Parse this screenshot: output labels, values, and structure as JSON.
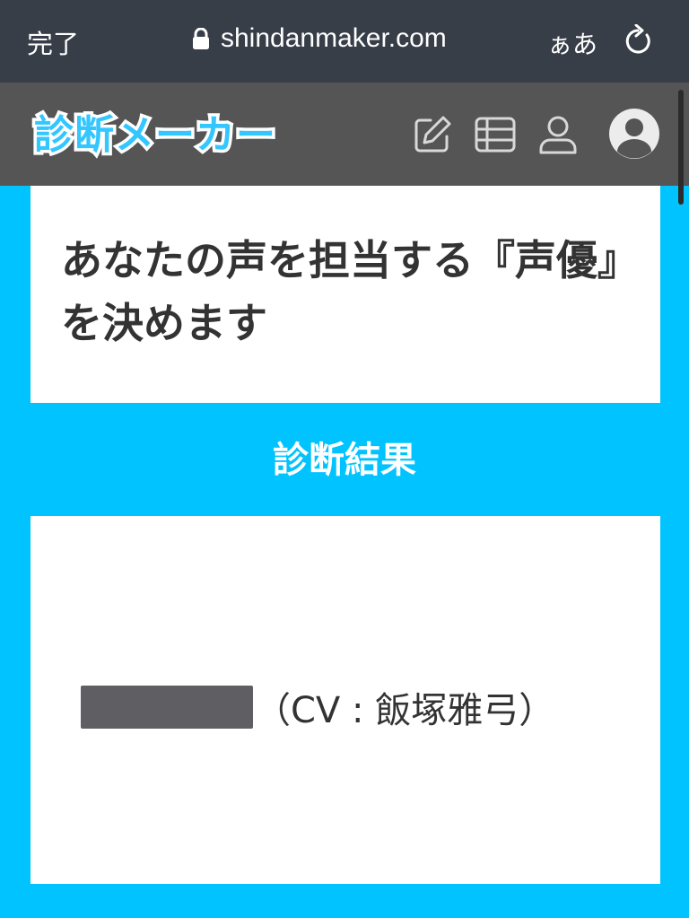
{
  "browser": {
    "done_label": "完了",
    "url": "shindanmaker.com",
    "text_size_label": "ぁあ",
    "icons": [
      "lock-icon",
      "reload-icon"
    ]
  },
  "header": {
    "logo_text": "診断メーカー",
    "icons": [
      "edit-icon",
      "list-icon",
      "user-icon",
      "avatar-icon"
    ]
  },
  "diagnosis": {
    "title": "あなたの声を担当する『声優』を決めます",
    "result_heading": "診断結果",
    "result_text": "（CV : 飯塚雅弓）"
  },
  "colors": {
    "page_background": "#00c3ff",
    "safari_bar": "#373e48",
    "site_header": "#555555",
    "logo": "#33c6ff"
  }
}
